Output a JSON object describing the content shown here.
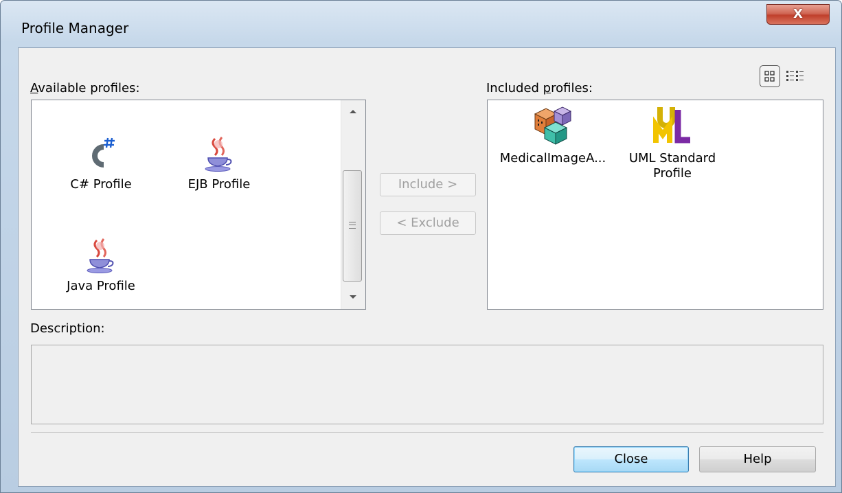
{
  "window": {
    "title": "Profile Manager",
    "close_glyph": "X"
  },
  "available": {
    "label_prefix": "A",
    "label_rest": "vailable profiles:",
    "items": [
      {
        "label": "C# Profile",
        "icon": "csharp-icon"
      },
      {
        "label": "EJB Profile",
        "icon": "java-cup-icon"
      },
      {
        "label": "Java Profile",
        "icon": "java-cup-icon"
      }
    ]
  },
  "included": {
    "label_before": "Included ",
    "label_underlined": "p",
    "label_after": "rofiles:",
    "items": [
      {
        "label": "MedicalImageA...",
        "icon": "building-blocks-icon"
      },
      {
        "label_line1": "UML Standard",
        "label_line2": "Profile",
        "icon": "uml-icon"
      }
    ]
  },
  "buttons": {
    "include": "Include >",
    "exclude": "< Exclude",
    "close": "Close",
    "help": "Help"
  },
  "description": {
    "label": "Description:",
    "value": ""
  },
  "view_toggle": {
    "active": "large-icons",
    "icons": [
      "large-icons-view-icon",
      "list-view-icon"
    ]
  }
}
